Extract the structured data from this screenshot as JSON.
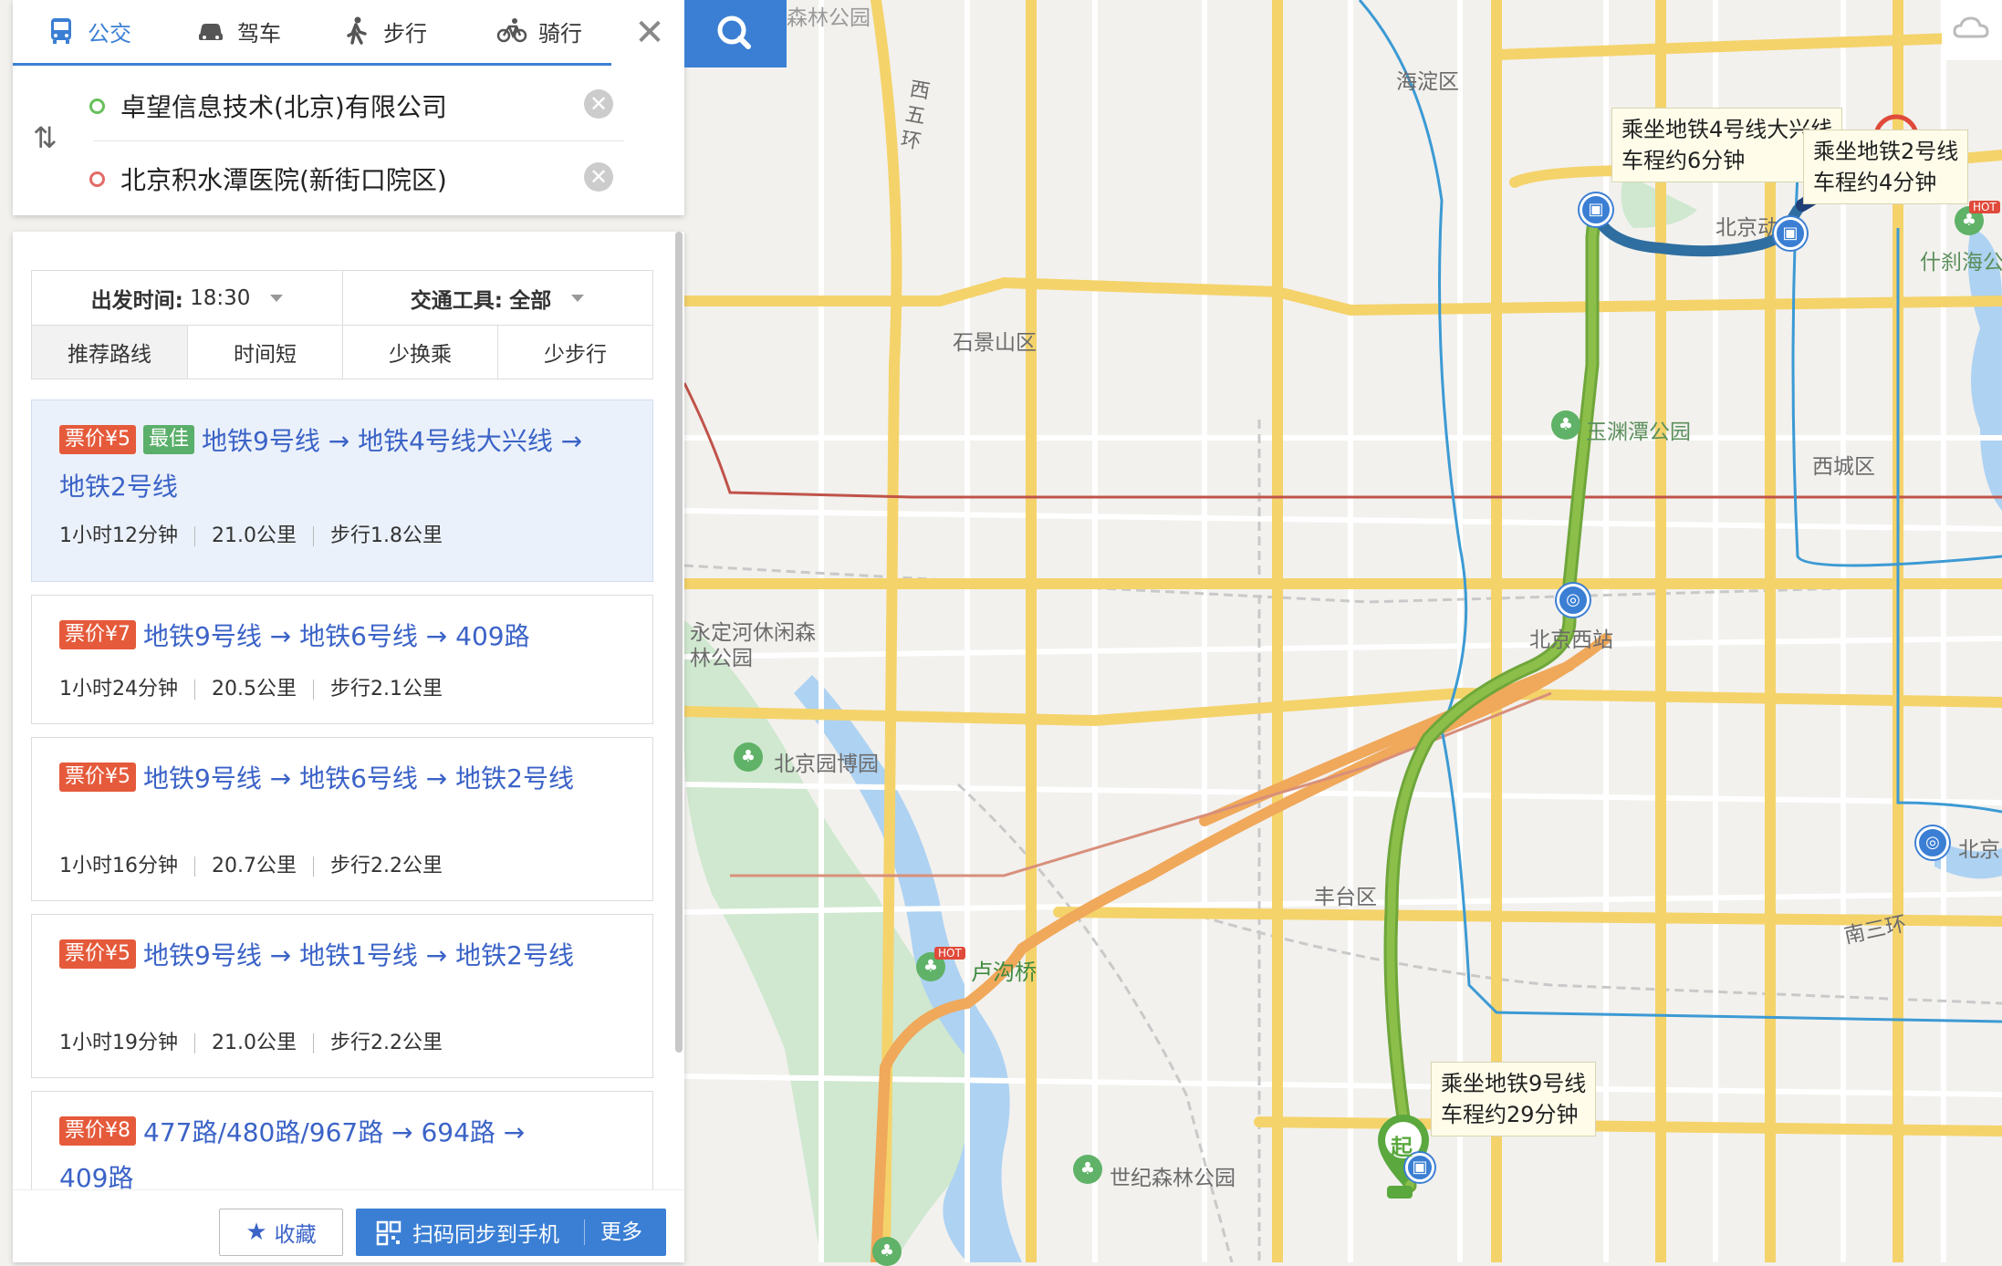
{
  "mode_tabs": [
    {
      "label": "公交",
      "icon": "bus-icon",
      "active": true
    },
    {
      "label": "驾车",
      "icon": "car-icon",
      "active": false
    },
    {
      "label": "步行",
      "icon": "walk-icon",
      "active": false
    },
    {
      "label": "骑行",
      "icon": "bike-icon",
      "active": false
    }
  ],
  "origin": "卓望信息技术(北京)有限公司",
  "destination": "北京积水潭医院(新街口院区)",
  "filters": {
    "depart_label": "出发时间:",
    "depart_value": "18:30",
    "vehicle_label": "交通工具:",
    "vehicle_value": "全部",
    "sort_tabs": [
      "推荐路线",
      "时间短",
      "少换乘",
      "少步行"
    ]
  },
  "routes": [
    {
      "fare": "票价¥5",
      "badge": "最佳",
      "title": "地铁9号线 → 地铁4号线大兴线 → 地铁2号线",
      "duration": "1小时12分钟",
      "distance": "21.0公里",
      "walk": "步行1.8公里"
    },
    {
      "fare": "票价¥7",
      "badge": "",
      "title": "地铁9号线 → 地铁6号线 → 409路",
      "duration": "1小时24分钟",
      "distance": "20.5公里",
      "walk": "步行2.1公里"
    },
    {
      "fare": "票价¥5",
      "badge": "",
      "title": "地铁9号线 → 地铁6号线 → 地铁2号线",
      "duration": "1小时16分钟",
      "distance": "20.7公里",
      "walk": "步行2.2公里"
    },
    {
      "fare": "票价¥5",
      "badge": "",
      "title": "地铁9号线 → 地铁1号线 → 地铁2号线",
      "duration": "1小时19分钟",
      "distance": "21.0公里",
      "walk": "步行2.2公里"
    },
    {
      "fare": "票价¥8",
      "badge": "",
      "title": "477路/480路/967路 → 694路 → 409路",
      "duration": "",
      "distance": "",
      "walk": ""
    }
  ],
  "actions": {
    "favorite": "收藏",
    "sync": "扫码同步到手机",
    "more": "更多"
  },
  "map": {
    "labels": {
      "haidian": "海淀区",
      "xisihuan": "西五环",
      "shijingshan": "石景山区",
      "xicheng": "西城区",
      "fengtai": "丰台区",
      "beijingxi": "北京西站",
      "yuyuantan": "玉渊潭公园",
      "yongding": "永定河休闲森林公园",
      "yuanbo": "北京园博园",
      "lugouqiao": "卢沟桥",
      "shiji": "世纪森林公园",
      "shichahai": "什刹海公",
      "nansanhuan": "南三环",
      "beijingdong": "北京动",
      "forest_top": "森林公园",
      "beijing_r": "北京",
      "start_marker": "起",
      "hot": "HOT"
    },
    "callouts": {
      "line9": [
        "乘坐地铁9号线",
        "车程约29分钟"
      ],
      "line4": [
        "乘坐地铁4号线大兴线",
        "车程约6分钟"
      ],
      "line2": [
        "乘坐地铁2号线",
        "车程约4分钟"
      ]
    },
    "colors": {
      "route_green": "#8cbf4a",
      "route_blue": "#2f6ea0",
      "road_yellow": "#f5d36b",
      "accent": "#3b7fd4",
      "fare": "#e55a3b",
      "best": "#5aaf6a"
    }
  }
}
